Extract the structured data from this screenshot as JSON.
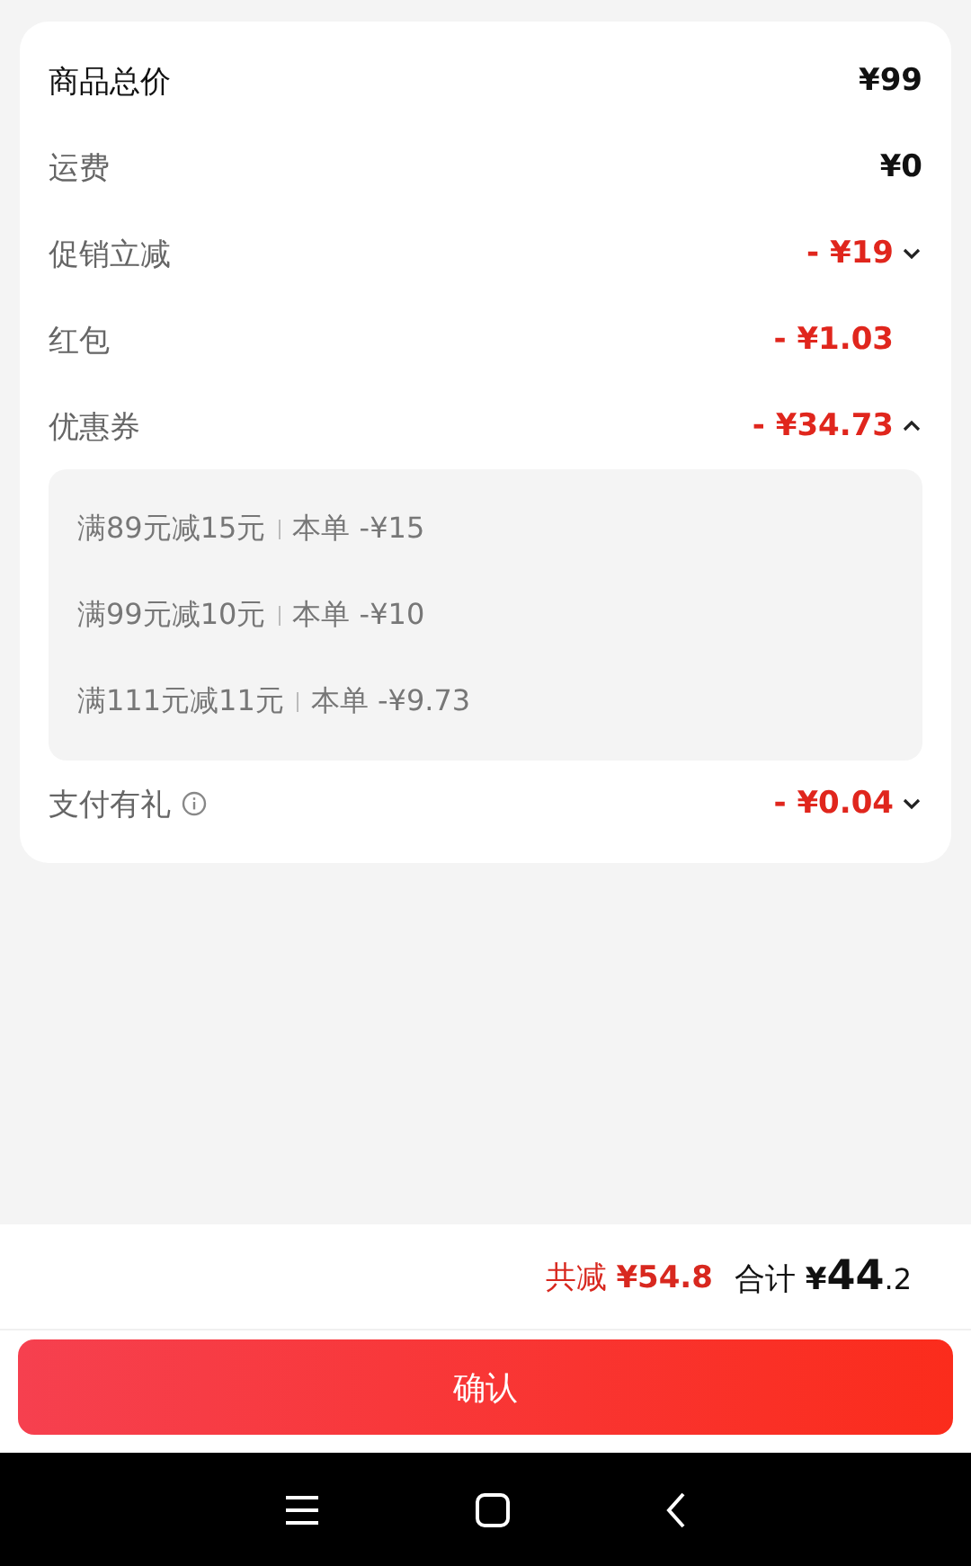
{
  "summary_rows": [
    {
      "label": "商品总价",
      "value": "¥99",
      "kind": "total",
      "info": false
    },
    {
      "label": "运费",
      "value": "¥0",
      "kind": "fee",
      "info": false
    },
    {
      "label": "促销立减",
      "value": "- ¥19",
      "kind": "discount",
      "info": false,
      "expanded": false
    },
    {
      "label": "红包",
      "value": "- ¥1.03",
      "kind": "discount",
      "info": false
    },
    {
      "label": "优惠券",
      "value": "- ¥34.73",
      "kind": "discount",
      "info": false,
      "expanded": true,
      "coupons": [
        {
          "rule": "满89元减15元",
          "saving": "本单 -¥15"
        },
        {
          "rule": "满99元减10元",
          "saving": "本单 -¥10"
        },
        {
          "rule": "满111元减11元",
          "saving": "本单 -¥9.73"
        }
      ]
    },
    {
      "label": "支付有礼",
      "value": "- ¥0.04",
      "kind": "discount",
      "info": true,
      "expanded": false
    }
  ],
  "footer": {
    "saved_label": "共减",
    "saved_value": "¥54.8",
    "total_label": "合计",
    "total_currency": "¥",
    "total_integer": "44",
    "total_decimal": ".2",
    "confirm_button": "确认"
  }
}
